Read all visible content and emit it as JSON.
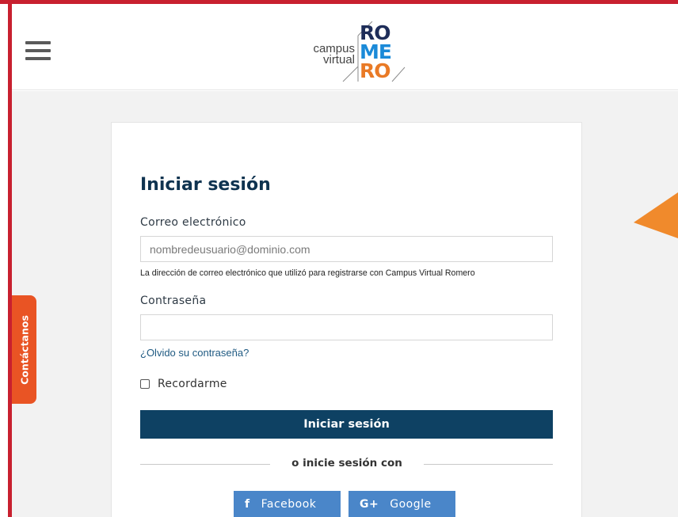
{
  "header": {
    "menu_icon": "hamburger-menu-icon",
    "logo": {
      "line1": "campus",
      "line2": "virtual",
      "word_ro": "RO",
      "word_me": "ME",
      "word_ro2": "RO",
      "colors": {
        "ro": "#1e2d59",
        "me": "#1b8ad8",
        "ro2": "#e97a26"
      }
    }
  },
  "login": {
    "title": "Iniciar sesión",
    "email_label": "Correo electrónico",
    "email_placeholder": "nombredeusuario@dominio.com",
    "email_hint": "La dirección de correo electrónico que utilizó para registrarse con Campus Virtual Romero",
    "password_label": "Contraseña",
    "password_value": "",
    "forgot_link": "¿Olvido su contraseña?",
    "remember_label": "Recordarme",
    "remember_checked": false,
    "submit_label": "Iniciar sesión",
    "divider_text": "o inicie sesión con",
    "social": [
      {
        "icon": "f",
        "label": "Facebook"
      },
      {
        "icon": "G+",
        "label": "Google"
      }
    ]
  },
  "contact_tab": {
    "label": "Contáctanos"
  },
  "colors": {
    "frame": "#c8202f",
    "primary_button": "#0e4163",
    "social_button": "#4a86c9",
    "contact_tab": "#e95424",
    "triangle": "#f08a2c",
    "background": "#f2f2f2"
  }
}
